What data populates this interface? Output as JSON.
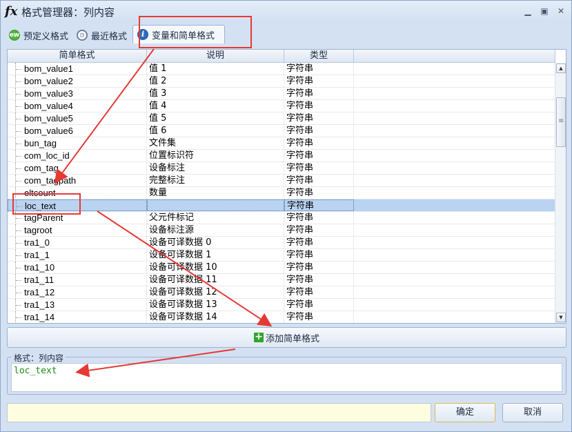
{
  "window": {
    "title": "格式管理器：列内容",
    "title_icon": "fx"
  },
  "tabs": [
    {
      "label": "预定义格式",
      "icon": "ew-icon",
      "active": false
    },
    {
      "label": "最近格式",
      "icon": "clock-icon",
      "active": false
    },
    {
      "label": "变量和简单格式",
      "icon": "info-icon",
      "active": true
    }
  ],
  "grid": {
    "columns": [
      "简单格式",
      "说明",
      "类型"
    ],
    "rows": [
      {
        "name": "bom_value1",
        "desc": "值 1",
        "type": "字符串"
      },
      {
        "name": "bom_value2",
        "desc": "值 2",
        "type": "字符串"
      },
      {
        "name": "bom_value3",
        "desc": "值 3",
        "type": "字符串"
      },
      {
        "name": "bom_value4",
        "desc": "值 4",
        "type": "字符串"
      },
      {
        "name": "bom_value5",
        "desc": "值 5",
        "type": "字符串"
      },
      {
        "name": "bom_value6",
        "desc": "值 6",
        "type": "字符串"
      },
      {
        "name": "bun_tag",
        "desc": "文件集",
        "type": "字符串"
      },
      {
        "name": "com_loc_id",
        "desc": "位置标识符",
        "type": "字符串"
      },
      {
        "name": "com_tag",
        "desc": "设备标注",
        "type": "字符串"
      },
      {
        "name": "com_tagpath",
        "desc": "完整标注",
        "type": "字符串"
      },
      {
        "name": "eltcount",
        "desc": "数量",
        "type": "字符串"
      },
      {
        "name": "loc_text",
        "desc": "",
        "type": "字符串",
        "selected": true
      },
      {
        "name": "tagParent",
        "desc": "父元件标记",
        "type": "字符串"
      },
      {
        "name": "tagroot",
        "desc": "设备标注源",
        "type": "字符串"
      },
      {
        "name": "tra1_0",
        "desc": "设备可译数据 0",
        "type": "字符串"
      },
      {
        "name": "tra1_1",
        "desc": "设备可译数据 1",
        "type": "字符串"
      },
      {
        "name": "tra1_10",
        "desc": "设备可译数据 10",
        "type": "字符串"
      },
      {
        "name": "tra1_11",
        "desc": "设备可译数据 11",
        "type": "字符串"
      },
      {
        "name": "tra1_12",
        "desc": "设备可译数据 12",
        "type": "字符串"
      },
      {
        "name": "tra1_13",
        "desc": "设备可译数据 13",
        "type": "字符串"
      },
      {
        "name": "tra1_14",
        "desc": "设备可译数据 14",
        "type": "字符串"
      }
    ]
  },
  "add_button": {
    "label": "添加简单格式"
  },
  "format": {
    "legend": "格式：列内容",
    "value": "loc_text"
  },
  "buttons": {
    "ok": "确定",
    "cancel": "取消"
  },
  "colors": {
    "annotation": "#e53935",
    "format_text": "#1a8a1a",
    "selection": "#b9d3f1"
  }
}
